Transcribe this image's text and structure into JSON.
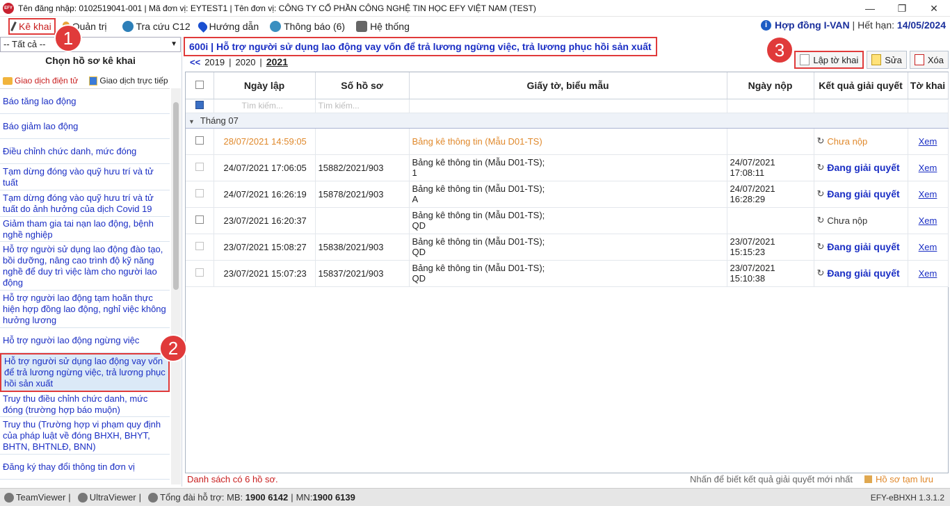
{
  "window": {
    "app_logo": "EFY",
    "title": "Tên đăng nhập: 0102519041-001 | Mã đơn vị: EYTEST1 | Tên đơn vị: CÔNG TY CỔ PHẦN CÔNG NGHỆ TIN HỌC EFY VIỆT NAM (TEST)",
    "buttons": {
      "minimize": "—",
      "restore": "❐",
      "close": "✕"
    }
  },
  "menu": {
    "items": [
      {
        "label": "Kê khai",
        "icon": "pencil-icon"
      },
      {
        "label": "Quản trị",
        "icon": "user-icon"
      },
      {
        "label": "Tra cứu C12",
        "icon": "globe-icon"
      },
      {
        "label": "Hướng dẫn",
        "icon": "location-pin-icon"
      },
      {
        "label": "Thông báo (6)",
        "icon": "globe-icon"
      },
      {
        "label": "Hệ thống",
        "icon": "gears-icon"
      }
    ]
  },
  "contract": {
    "label": "Hợp đồng I-VAN",
    "expiry_label": "Hết hạn:",
    "expiry_date": "14/05/2024"
  },
  "sidebar": {
    "filter_value": "-- Tất cả --",
    "title": "Chọn hồ sơ kê khai",
    "tabs": [
      {
        "label": "Giao dịch điện tử"
      },
      {
        "label": "Giao dịch trực tiếp"
      }
    ],
    "items": [
      {
        "label": "Báo tăng lao động"
      },
      {
        "label": "Báo giảm lao động"
      },
      {
        "label": "Điều chỉnh chức danh, mức đóng"
      },
      {
        "label": "Tạm dừng đóng vào quỹ hưu trí và tử tuất"
      },
      {
        "label": "Tạm dừng đóng vào quỹ hưu trí và tử tuất do ảnh hưởng của dịch Covid 19"
      },
      {
        "label": "Giảm tham gia tai nạn lao động, bệnh nghề nghiệp"
      },
      {
        "label": "Hỗ trợ người sử dụng lao động đào tạo, bồi dưỡng, nâng cao trình độ kỹ năng nghề để duy trì việc làm cho người lao động"
      },
      {
        "label": "Hỗ trợ người lao động tạm hoãn thực hiện hợp đồng lao động, nghỉ việc không hưởng lương"
      },
      {
        "label": "Hỗ trợ người lao động ngừng việc"
      },
      {
        "label": "Hỗ trợ người sử dụng lao động vay vốn để trả lương ngừng việc, trả lương phục hồi sản xuất"
      },
      {
        "label": "Truy thu điều chỉnh chức danh, mức đóng (trường hợp báo muộn)"
      },
      {
        "label": "Truy thu (Trường hợp vi phạm quy định của pháp luật về đóng BHXH, BHYT, BHTN, BHTNLĐ, BNN)"
      },
      {
        "label": "Đăng ký thay đổi thông tin đơn vị"
      }
    ]
  },
  "main": {
    "heading": "600i | Hỗ trợ người sử dụng lao động vay vốn để trả lương ngừng việc, trả lương phục hồi sản xuất",
    "years": {
      "prev": "<<",
      "list": [
        "2019",
        "|",
        "2020",
        "|"
      ],
      "current": "2021"
    },
    "toolbar": {
      "create": "Lập tờ khai",
      "edit": "Sửa",
      "delete": "Xóa"
    },
    "columns": [
      "Ngày lập",
      "Số hồ sơ",
      "Giấy tờ, biểu mẫu",
      "Ngày nộp",
      "Kết quả giải quyết",
      "Tờ khai"
    ],
    "search_placeholder": "Tìm kiếm...",
    "group": "Tháng 07",
    "rows": [
      {
        "date": "28/07/2021 14:59:05",
        "number": "",
        "form": "Bảng kê thông tin (Mẫu D01-TS)",
        "form2": "",
        "submitted": "",
        "status": "Chưa nộp",
        "view": "Xem"
      },
      {
        "date": "24/07/2021 17:06:05",
        "number": "15882/2021/903",
        "form": "Bảng kê thông tin (Mẫu D01-TS);",
        "form2": "1",
        "submitted": "24/07/2021 17:08:11",
        "status": "Đang giải quyết",
        "view": "Xem"
      },
      {
        "date": "24/07/2021 16:26:19",
        "number": "15878/2021/903",
        "form": "Bảng kê thông tin (Mẫu D01-TS);",
        "form2": "A",
        "submitted": "24/07/2021 16:28:29",
        "status": "Đang giải quyết",
        "view": "Xem"
      },
      {
        "date": "23/07/2021 16:20:37",
        "number": "",
        "form": "Bảng kê thông tin (Mẫu D01-TS);",
        "form2": "QD",
        "submitted": "",
        "status": "Chưa nộp",
        "view": "Xem"
      },
      {
        "date": "23/07/2021 15:08:27",
        "number": "15838/2021/903",
        "form": "Bảng kê thông tin (Mẫu D01-TS);",
        "form2": "QD",
        "submitted": "23/07/2021 15:15:23",
        "status": "Đang giải quyết",
        "view": "Xem"
      },
      {
        "date": "23/07/2021 15:07:23",
        "number": "15837/2021/903",
        "form": "Bảng kê thông tin (Mẫu D01-TS);",
        "form2": "QD",
        "submitted": "23/07/2021 15:10:38",
        "status": "Đang giải quyết",
        "view": "Xem"
      }
    ],
    "count_text": "Danh sách có 6 hồ sơ.",
    "hint": "Nhấn để biết kết quả giải quyết mới nhất",
    "saved_legend": "Hồ sơ tạm lưu"
  },
  "annotations": {
    "b1": "1",
    "b2": "2",
    "b3": "3"
  },
  "statusbar": {
    "teamviewer": "TeamViewer",
    "ultraviewer": "UltraViewer",
    "support": "Tổng đài hỗ trợ: MB:",
    "mb": "1900 6142",
    "mn_label": "MN:",
    "mn": "1900 6139",
    "version": "EFY-eBHXH 1.3.1.2"
  }
}
